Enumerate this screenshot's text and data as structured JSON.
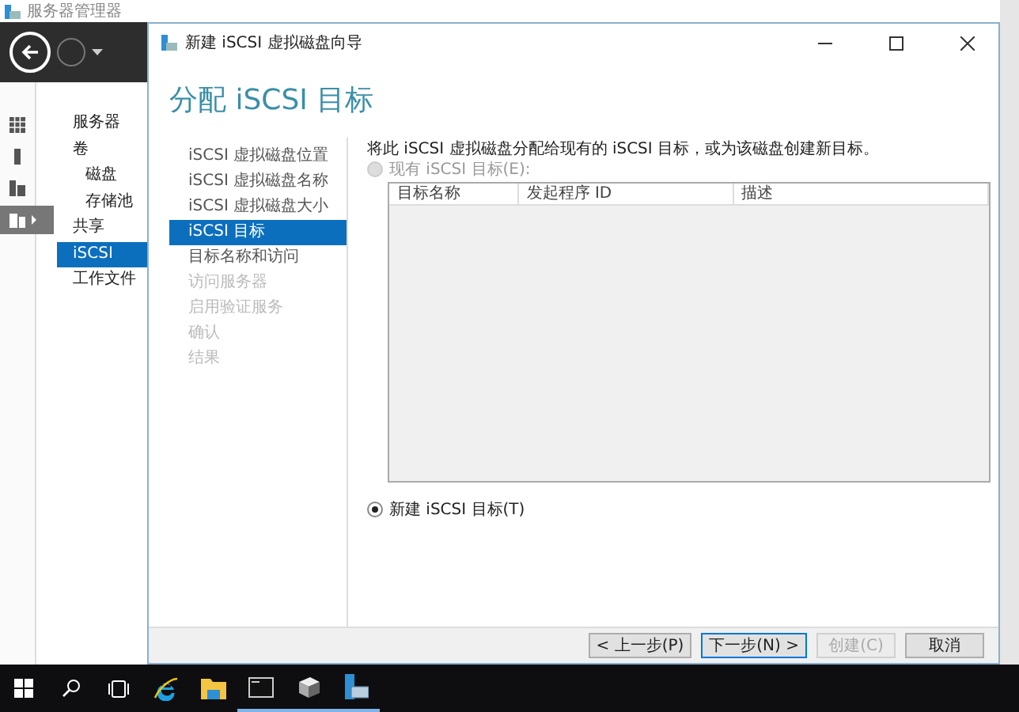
{
  "server_manager": {
    "title": "服务器管理器",
    "rail_items": [
      {
        "selected": false
      },
      {
        "selected": false
      },
      {
        "selected": false
      },
      {
        "selected": true
      }
    ],
    "nav_items": [
      {
        "label": "服务器",
        "selected": false
      },
      {
        "label": "卷",
        "selected": false,
        "children": [
          {
            "label": "磁盘",
            "selected": false
          },
          {
            "label": "存储池",
            "selected": false
          }
        ]
      },
      {
        "label": "共享",
        "selected": false
      },
      {
        "label": "iSCSI",
        "selected": true
      },
      {
        "label": "工作文件",
        "selected": false
      }
    ]
  },
  "dialog": {
    "title": "新建 iSCSI 虚拟磁盘向导",
    "heading": "分配 iSCSI 目标",
    "steps": [
      {
        "label": "iSCSI 虚拟磁盘位置",
        "selected": false,
        "disabled": false
      },
      {
        "label": "iSCSI 虚拟磁盘名称",
        "selected": false,
        "disabled": false
      },
      {
        "label": "iSCSI 虚拟磁盘大小",
        "selected": false,
        "disabled": false
      },
      {
        "label": "iSCSI 目标",
        "selected": true,
        "disabled": false
      },
      {
        "label": "目标名称和访问",
        "selected": false,
        "disabled": false
      },
      {
        "label": "访问服务器",
        "selected": false,
        "disabled": true
      },
      {
        "label": "启用验证服务",
        "selected": false,
        "disabled": true
      },
      {
        "label": "确认",
        "selected": false,
        "disabled": true
      },
      {
        "label": "结果",
        "selected": false,
        "disabled": true
      }
    ],
    "description": "将此 iSCSI 虚拟磁盘分配给现有的 iSCSI 目标，或为该磁盘创建新目标。",
    "existing_option": {
      "label": "现有 iSCSI 目标(E):",
      "selected": false,
      "disabled": true
    },
    "table": {
      "columns": [
        "目标名称",
        "发起程序 ID",
        "描述"
      ]
    },
    "new_option": {
      "label": "新建 iSCSI 目标(T)",
      "selected": true,
      "disabled": false
    },
    "buttons": [
      {
        "label": "< 上一步(P)",
        "disabled": false,
        "default": false
      },
      {
        "label": "下一步(N) >",
        "disabled": false,
        "default": true
      },
      {
        "label": "创建(C)",
        "disabled": true,
        "default": false
      },
      {
        "label": "取消",
        "disabled": false,
        "default": false
      }
    ]
  },
  "taskbar": {
    "items": [
      {
        "kind": "start",
        "active": false
      },
      {
        "kind": "search",
        "active": false
      },
      {
        "kind": "taskview",
        "active": false
      },
      {
        "kind": "browser",
        "active": false
      },
      {
        "kind": "folder",
        "active": false
      },
      {
        "kind": "console",
        "active": true
      },
      {
        "kind": "tools",
        "active": true
      },
      {
        "kind": "server",
        "active": true
      }
    ]
  }
}
